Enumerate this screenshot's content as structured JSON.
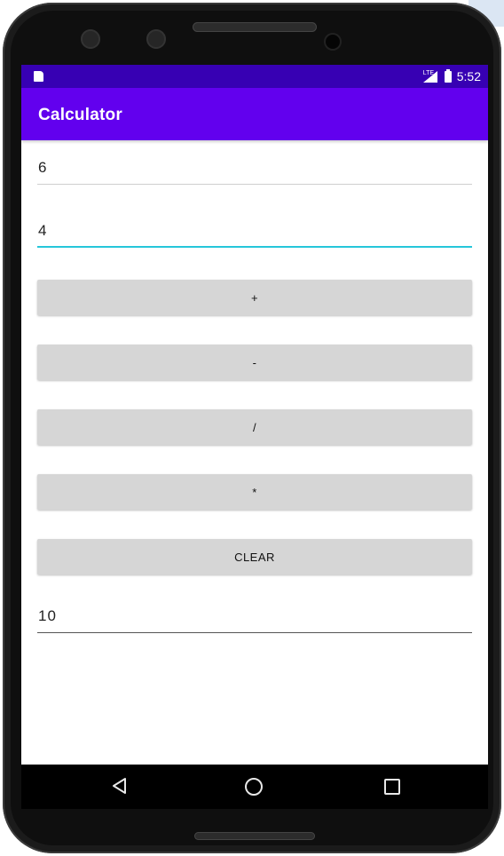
{
  "status_bar": {
    "time": "5:52",
    "network": "LTE",
    "icons": [
      "sim-card-icon",
      "signal-icon",
      "battery-icon"
    ]
  },
  "app_bar": {
    "title": "Calculator",
    "color": "#6200ee",
    "status_color": "#3700b3"
  },
  "inputs": {
    "first_value": "6",
    "second_value": "4"
  },
  "buttons": {
    "add": "+",
    "subtract": "-",
    "divide": "/",
    "multiply": "*",
    "clear": "CLEAR"
  },
  "result": {
    "value": "10"
  },
  "nav_bar": {
    "icons": [
      "back-icon",
      "home-icon",
      "recent-apps-icon"
    ]
  },
  "colors": {
    "accent": "#26c6da",
    "button_bg": "#d6d6d6"
  }
}
